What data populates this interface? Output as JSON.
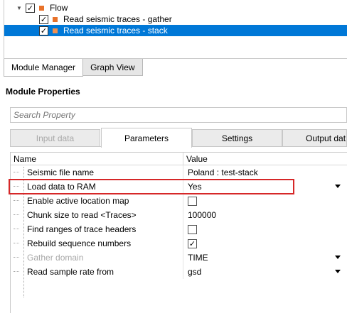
{
  "flow_tree": {
    "root": {
      "label": "Flow",
      "checked": true
    },
    "children": [
      {
        "label": "Read seismic traces - gather",
        "checked": true,
        "selected": false
      },
      {
        "label": "Read seismic traces - stack",
        "checked": true,
        "selected": true
      }
    ]
  },
  "bottom_tabs": [
    {
      "label": "Module Manager",
      "active": true
    },
    {
      "label": "Graph View",
      "active": false
    }
  ],
  "module_properties": {
    "title": "Module Properties",
    "search": {
      "placeholder": "Search Property",
      "value": ""
    },
    "tabs": [
      {
        "label": "Input data",
        "state": "disabled"
      },
      {
        "label": "Parameters",
        "state": "active"
      },
      {
        "label": "Settings",
        "state": "normal"
      },
      {
        "label": "Output dat",
        "state": "normal"
      }
    ],
    "grid": {
      "columns": {
        "name": "Name",
        "value": "Value"
      },
      "rows": [
        {
          "name": "Seismic file name",
          "value": "Poland : test-stack",
          "type": "text",
          "enabled": true
        },
        {
          "name": "Load data to RAM",
          "value": "Yes",
          "type": "dropdown",
          "enabled": true,
          "highlighted": true
        },
        {
          "name": "Enable active location map",
          "value": "",
          "type": "checkbox",
          "checked": false,
          "enabled": true
        },
        {
          "name": "Chunk size to read <Traces>",
          "value": "100000",
          "type": "text",
          "enabled": true
        },
        {
          "name": "Find ranges of trace headers",
          "value": "",
          "type": "checkbox",
          "checked": false,
          "enabled": true
        },
        {
          "name": "Rebuild sequence numbers",
          "value": "",
          "type": "checkbox",
          "checked": true,
          "enabled": true
        },
        {
          "name": "Gather domain",
          "value": "TIME",
          "type": "dropdown",
          "enabled": false
        },
        {
          "name": "Read sample rate from",
          "value": "gsd",
          "type": "dropdown",
          "enabled": true
        }
      ]
    }
  },
  "colors": {
    "selection": "#0078d7",
    "highlight_box": "#d62728",
    "module_icon": "#e8722a"
  },
  "icons": {
    "expand": "chevron-down-icon",
    "checked": "checkmark-icon",
    "module": "orange-square-icon",
    "dropdown": "dropdown-arrow-icon"
  }
}
